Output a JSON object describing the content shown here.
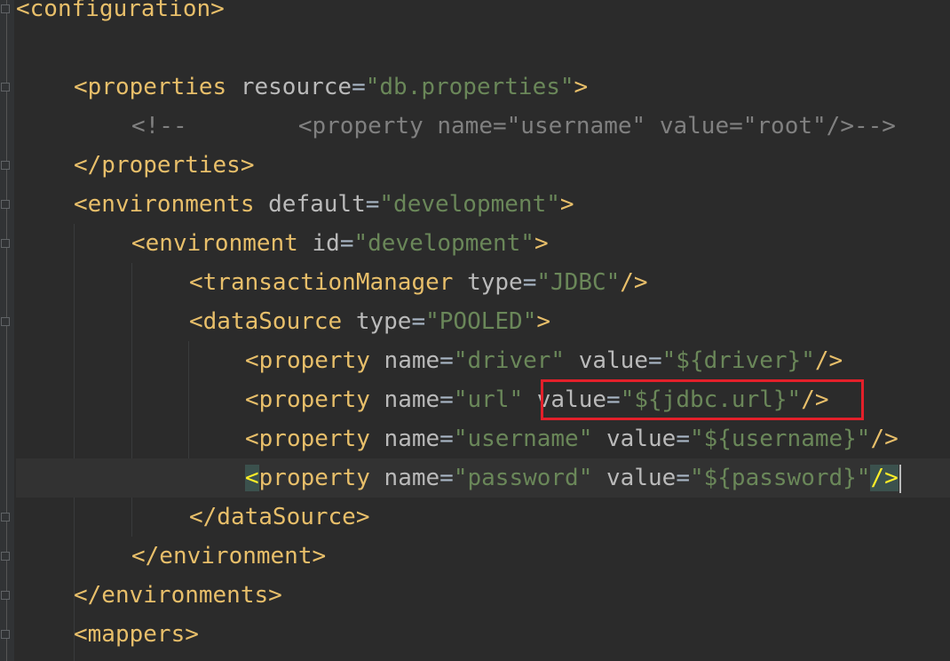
{
  "editor": {
    "language": "xml",
    "lines": [
      {
        "id": "configuration-open",
        "tokens": [
          [
            "t",
            "<configuration"
          ],
          [
            "t",
            ">"
          ]
        ]
      },
      {
        "id": "blank",
        "tokens": []
      },
      {
        "id": "properties-open",
        "tokens": [
          [
            "t",
            "<properties"
          ],
          [
            "x",
            " "
          ],
          [
            "an",
            "resource"
          ],
          [
            "eq",
            "="
          ],
          [
            "av",
            "\"db.properties\""
          ],
          [
            "t",
            ">"
          ]
        ]
      },
      {
        "id": "comment",
        "tokens": [
          [
            "cm",
            "<!--        <property name=\"username\" value=\"root\"/>-->"
          ]
        ]
      },
      {
        "id": "properties-close",
        "tokens": [
          [
            "t",
            "</properties>"
          ]
        ]
      },
      {
        "id": "environments-open",
        "tokens": [
          [
            "t",
            "<environments"
          ],
          [
            "x",
            " "
          ],
          [
            "an",
            "default"
          ],
          [
            "eq",
            "="
          ],
          [
            "av",
            "\"development\""
          ],
          [
            "t",
            ">"
          ]
        ]
      },
      {
        "id": "environment-open",
        "tokens": [
          [
            "t",
            "<environment"
          ],
          [
            "x",
            " "
          ],
          [
            "an",
            "id"
          ],
          [
            "eq",
            "="
          ],
          [
            "av",
            "\"development\""
          ],
          [
            "t",
            ">"
          ]
        ]
      },
      {
        "id": "transaction-manager",
        "tokens": [
          [
            "t",
            "<transactionManager"
          ],
          [
            "x",
            " "
          ],
          [
            "an",
            "type"
          ],
          [
            "eq",
            "="
          ],
          [
            "av",
            "\"JDBC\""
          ],
          [
            "t",
            "/>"
          ]
        ]
      },
      {
        "id": "datasource-open",
        "tokens": [
          [
            "t",
            "<dataSource"
          ],
          [
            "x",
            " "
          ],
          [
            "an",
            "type"
          ],
          [
            "eq",
            "="
          ],
          [
            "av",
            "\"POOLED\""
          ],
          [
            "t",
            ">"
          ]
        ]
      },
      {
        "id": "property-driver",
        "tokens": [
          [
            "t",
            "<property"
          ],
          [
            "x",
            " "
          ],
          [
            "an",
            "name"
          ],
          [
            "eq",
            "="
          ],
          [
            "av",
            "\"driver\""
          ],
          [
            "x",
            " "
          ],
          [
            "an",
            "value"
          ],
          [
            "eq",
            "="
          ],
          [
            "av",
            "\"${driver}\""
          ],
          [
            "t",
            "/>"
          ]
        ]
      },
      {
        "id": "property-url",
        "tokens": [
          [
            "t",
            "<property"
          ],
          [
            "x",
            " "
          ],
          [
            "an",
            "name"
          ],
          [
            "eq",
            "="
          ],
          [
            "av",
            "\"url\""
          ],
          [
            "x",
            " "
          ],
          [
            "an",
            "value"
          ],
          [
            "eq",
            "="
          ],
          [
            "av",
            "\"${jdbc.url}\""
          ],
          [
            "t",
            "/>"
          ]
        ]
      },
      {
        "id": "property-username",
        "tokens": [
          [
            "t",
            "<property"
          ],
          [
            "x",
            " "
          ],
          [
            "an",
            "name"
          ],
          [
            "eq",
            "="
          ],
          [
            "av",
            "\"username\""
          ],
          [
            "x",
            " "
          ],
          [
            "an",
            "value"
          ],
          [
            "eq",
            "="
          ],
          [
            "av",
            "\"${username}\""
          ],
          [
            "t",
            "/>"
          ]
        ]
      },
      {
        "id": "property-password",
        "tokens": [
          [
            "m",
            "<"
          ],
          [
            "t",
            "property"
          ],
          [
            "x",
            " "
          ],
          [
            "an",
            "name"
          ],
          [
            "eq",
            "="
          ],
          [
            "av",
            "\"password\""
          ],
          [
            "x",
            " "
          ],
          [
            "an",
            "value"
          ],
          [
            "eq",
            "="
          ],
          [
            "av",
            "\"${password}\""
          ],
          [
            "m",
            "/>"
          ],
          [
            "c",
            ""
          ]
        ]
      },
      {
        "id": "datasource-close",
        "tokens": [
          [
            "t",
            "</dataSource>"
          ]
        ]
      },
      {
        "id": "environment-close",
        "tokens": [
          [
            "t",
            "</environment>"
          ]
        ]
      },
      {
        "id": "environments-close",
        "tokens": [
          [
            "t",
            "</environments>"
          ]
        ]
      },
      {
        "id": "mappers-open",
        "tokens": [
          [
            "t",
            "<mappers>"
          ]
        ]
      }
    ]
  },
  "highlight": {
    "label": "value=\"${jdbc.url}\"/>",
    "color": "#e3202a"
  },
  "colors": {
    "background": "#2b2b2b",
    "tag": "#e8bf6a",
    "attribute_name": "#bababa",
    "attribute_value": "#6a8759",
    "comment": "#808080",
    "brace_match": "#ffef28"
  }
}
